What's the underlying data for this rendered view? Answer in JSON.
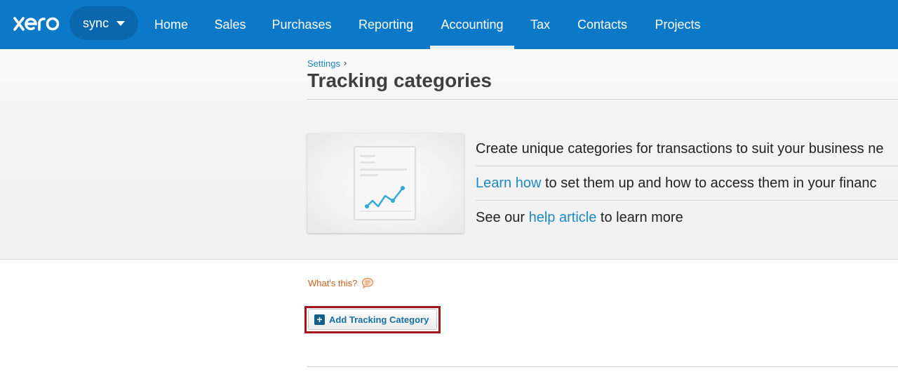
{
  "header": {
    "logo_text": "xero",
    "org_name": "sync",
    "nav": [
      "Home",
      "Sales",
      "Purchases",
      "Reporting",
      "Accounting",
      "Tax",
      "Contacts",
      "Projects"
    ],
    "active_nav": "Accounting"
  },
  "breadcrumb": {
    "parent": "Settings",
    "separator": "›"
  },
  "page_title": "Tracking categories",
  "intro": {
    "line1": "Create unique categories for transactions to suit your business ne",
    "line2_link": "Learn how",
    "line2_text": " to set them up and how to access them in your financ",
    "line3_pre": "See our ",
    "line3_link": "help article",
    "line3_post": " to learn more"
  },
  "whats_this": "What's this?",
  "add_button": "Add Tracking Category",
  "colors": {
    "topbar": "#0b78c8",
    "link": "#1d89c1",
    "whats_this": "#d0611b",
    "highlight": "#a0161a"
  }
}
